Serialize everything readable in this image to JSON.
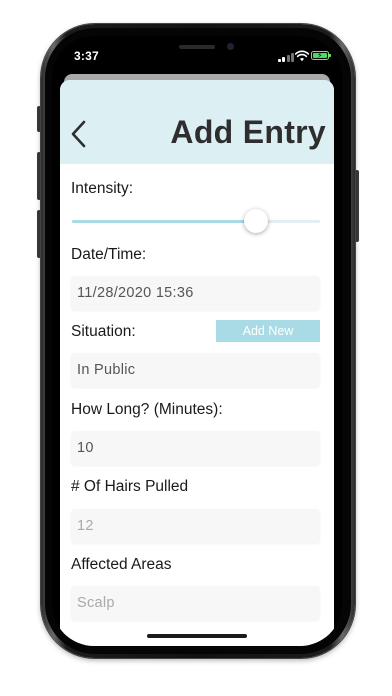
{
  "status_bar": {
    "time": "3:37",
    "icons": [
      "signal-icon",
      "wifi-icon",
      "battery-charging-icon"
    ]
  },
  "header": {
    "back_icon": "chevron-left-icon",
    "title": "Add Entry",
    "background": "#dcf0f4"
  },
  "form": {
    "intensity": {
      "label": "Intensity:",
      "value_fraction": 0.74
    },
    "datetime": {
      "label": "Date/Time:",
      "value": "11/28/2020 15:36"
    },
    "situation": {
      "label": "Situation:",
      "value": "In Public",
      "add_new_label": "Add New"
    },
    "duration": {
      "label": "How Long? (Minutes):",
      "value": "10"
    },
    "hairs": {
      "label": "# Of Hairs Pulled",
      "placeholder": "12"
    },
    "areas": {
      "label": "Affected Areas",
      "placeholder": "Scalp"
    }
  },
  "colors": {
    "accent": "#a9dbe6",
    "header_bg": "#dcf0f4",
    "title_text": "#2e2e2e",
    "field_bg": "#f7f7f7",
    "placeholder": "#a9a9a9"
  }
}
